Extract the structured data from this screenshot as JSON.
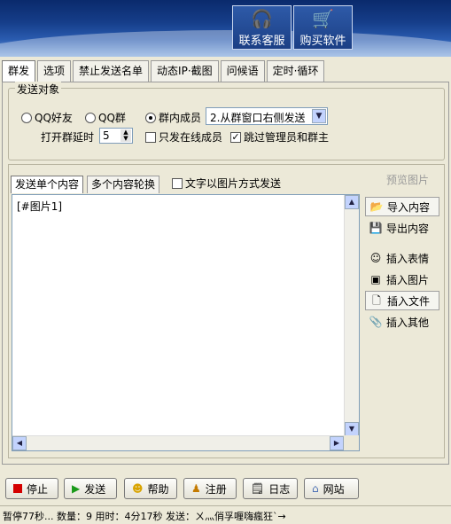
{
  "header": {
    "buttons": [
      {
        "label": "联系客服",
        "icon": "headset-icon"
      },
      {
        "label": "购买软件",
        "icon": "cart-icon"
      }
    ]
  },
  "tabs": [
    "群发",
    "选项",
    "禁止发送名单",
    "动态IP·截图",
    "问候语",
    "定时·循环"
  ],
  "target": {
    "legend": "发送对象",
    "radio_qq_friend": "QQ好友",
    "radio_qq_group": "QQ群",
    "radio_group_member": "群内成员",
    "selected_radio": "群内成员",
    "mode_select_value": "2.从群窗口右侧发送",
    "delay_label": "打开群延时",
    "delay_value": "5",
    "online_only_label": "只发在线成员",
    "online_only_checked": false,
    "skip_admin_label": "跳过管理员和群主",
    "skip_admin_checked": true
  },
  "content": {
    "subtab_single": "发送单个内容",
    "subtab_multi": "多个内容轮换",
    "text_as_image_label": "文字以图片方式发送",
    "text_as_image_checked": false,
    "preview_label": "预览图片",
    "editor_text": "[#图片1]",
    "side_buttons": [
      {
        "label": "导入内容",
        "icon": "folder-icon"
      },
      {
        "label": "导出内容",
        "icon": "save-icon"
      },
      {
        "label": "插入表情",
        "icon": "smiley-icon"
      },
      {
        "label": "插入图片",
        "icon": "image-icon"
      },
      {
        "label": "插入文件",
        "icon": "file-icon"
      },
      {
        "label": "插入其他",
        "icon": "attach-icon"
      }
    ]
  },
  "bottom_buttons": [
    {
      "label": "停止",
      "icon": "stop-icon"
    },
    {
      "label": "发送",
      "icon": "play-icon"
    },
    {
      "label": "帮助",
      "icon": "help-icon"
    },
    {
      "label": "注册",
      "icon": "user-icon"
    },
    {
      "label": "日志",
      "icon": "log-icon"
    },
    {
      "label": "网站",
      "icon": "home-icon"
    }
  ],
  "status_text": "暂停77秒... 数量：9 用时：4分17秒 发送：ㄨ灬俏孚喱嗨瘋狂ˋ→"
}
